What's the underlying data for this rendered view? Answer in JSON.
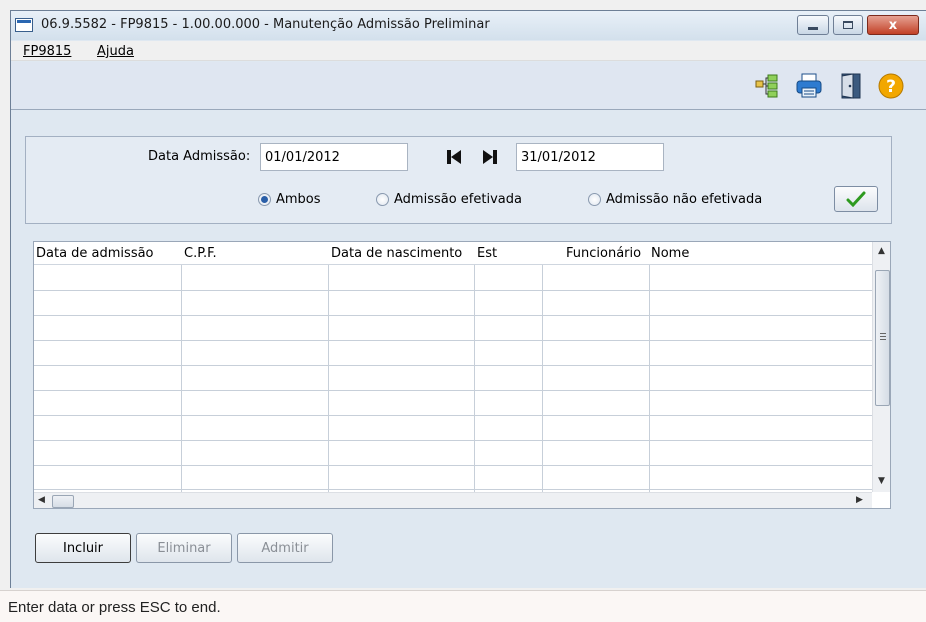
{
  "window": {
    "title": "06.9.5582 - FP9815 - 1.00.00.000 - Manutenção Admissão Preliminar",
    "close_glyph": "x"
  },
  "menu": {
    "items": [
      "FP9815",
      "Ajuda"
    ]
  },
  "toolbar": {
    "icons": [
      "tree-icon",
      "print-icon",
      "exit-door-icon",
      "help-icon"
    ]
  },
  "filter": {
    "data_admissao_label": "Data Admissão:",
    "date_start": "01/01/2012",
    "date_end": "31/01/2012",
    "radios": [
      {
        "label": "Ambos",
        "selected": true
      },
      {
        "label": "Admissão efetivada",
        "selected": false
      },
      {
        "label": "Admissão não efetivada",
        "selected": false
      }
    ]
  },
  "grid": {
    "columns": [
      "Data de admissão",
      "C.P.F.",
      "Data de nascimento",
      "Est",
      "Funcionário",
      "Nome"
    ],
    "rows": []
  },
  "buttons": {
    "incluir": "Incluir",
    "eliminar": "Eliminar",
    "admitir": "Admitir"
  },
  "status": {
    "text": "Enter data or press ESC to end."
  },
  "colors": {
    "accent": "#2a5fa8",
    "frame": "#dfe8f1",
    "close": "#c24127",
    "ok_check": "#2e9a1f",
    "help": "#f2a700"
  }
}
